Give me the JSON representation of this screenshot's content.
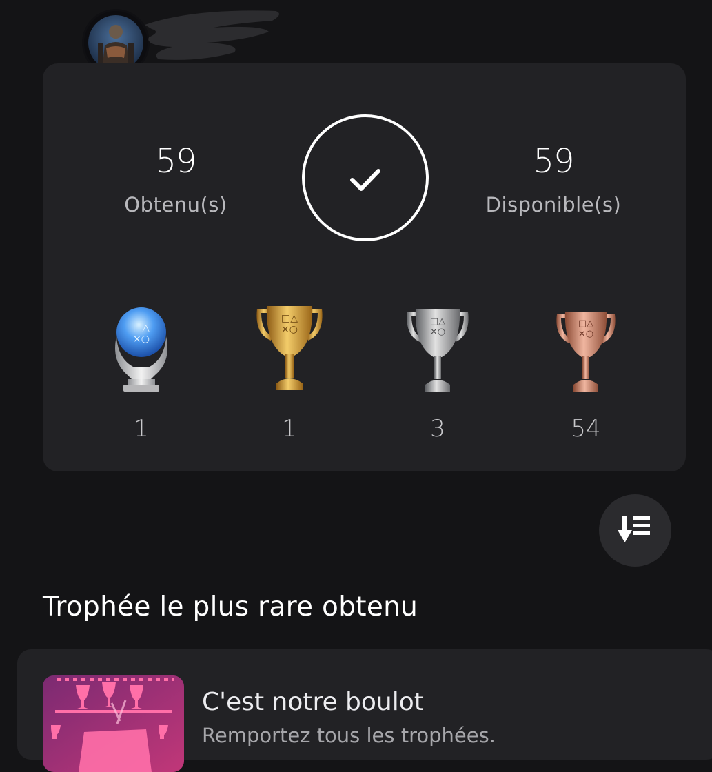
{
  "header": {
    "avatar_icon": "warrior-avatar-icon",
    "username": ""
  },
  "summary": {
    "earned_count": "59",
    "earned_label": "Obtenu(s)",
    "available_count": "59",
    "available_label": "Disponible(s)",
    "completion_icon": "checkmark-icon",
    "trophies": [
      {
        "type": "platinum",
        "icon": "platinum-trophy-icon",
        "count": "1"
      },
      {
        "type": "gold",
        "icon": "gold-trophy-icon",
        "count": "1"
      },
      {
        "type": "silver",
        "icon": "silver-trophy-icon",
        "count": "3"
      },
      {
        "type": "bronze",
        "icon": "bronze-trophy-icon",
        "count": "54"
      }
    ]
  },
  "sort_button": {
    "icon": "sort-descending-icon"
  },
  "rarest": {
    "section_title": "Trophée le plus rare obtenu",
    "trophy_name": "C'est notre boulot",
    "trophy_description": "Remportez tous les trophées."
  },
  "colors": {
    "background": "#141416",
    "card": "#222225",
    "gold": "#d6a341",
    "silver": "#b9b9b9",
    "bronze": "#c98a6e",
    "platinum": "#5aa8ff"
  }
}
